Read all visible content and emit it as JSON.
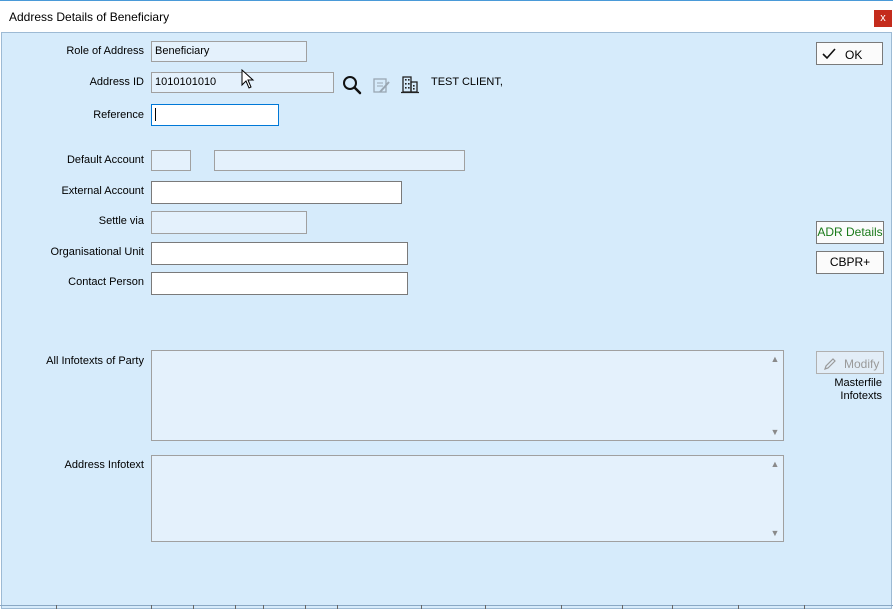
{
  "window": {
    "title": "Address Details of Beneficiary",
    "close_label": "x"
  },
  "form": {
    "role_of_address": {
      "label": "Role of Address",
      "value": "Beneficiary"
    },
    "address_id": {
      "label": "Address ID",
      "value": "1010101010",
      "client_name": "TEST CLIENT,"
    },
    "reference": {
      "label": "Reference",
      "value": ""
    },
    "default_account": {
      "label": "Default Account",
      "value_short": "",
      "value_long": ""
    },
    "external_account": {
      "label": "External Account",
      "value": ""
    },
    "settle_via": {
      "label": "Settle via",
      "value": ""
    },
    "organisational_unit": {
      "label": "Organisational Unit",
      "value": ""
    },
    "contact_person": {
      "label": "Contact Person",
      "value": ""
    },
    "all_infotexts": {
      "label": "All Infotexts of Party",
      "value": ""
    },
    "address_infotext": {
      "label": "Address Infotext",
      "value": ""
    }
  },
  "buttons": {
    "ok": "OK",
    "adr_details": "ADR Details",
    "cbpr": "CBPR+",
    "modify": "Modify",
    "masterfile_note_line1": "Masterfile",
    "masterfile_note_line2": "Infotexts"
  },
  "icons": {
    "search": "search-icon",
    "edit_address": "edit-address-icon",
    "building": "building-icon",
    "check": "check-icon",
    "pencil": "pencil-icon",
    "mouse_cursor": "mouse-cursor-icon"
  },
  "colors": {
    "client_bg": "#d6ebfb",
    "readonly_field_bg": "#e4f1fc",
    "close_button_bg": "#c42b1c",
    "adr_details_text": "#1a7a1a",
    "focus_border": "#0078d7"
  }
}
